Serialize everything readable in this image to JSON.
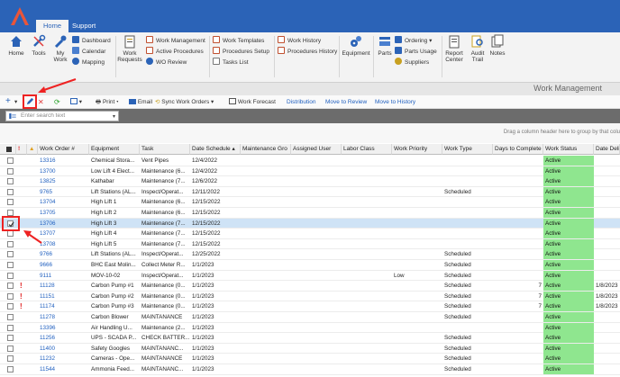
{
  "tabs": {
    "home": "Home",
    "support": "Support"
  },
  "ribbon": {
    "home": "Home",
    "tools": "Tools",
    "my_work": "My Work",
    "dashboard": "Dashboard",
    "calendar": "Calendar",
    "mapping": "Mapping",
    "work_requests": "Work Requests",
    "work_management": "Work Management",
    "active_procedures": "Active Procedures",
    "wo_review": "WO Review",
    "work_templates": "Work Templates",
    "procedures_setup": "Procedures Setup",
    "tasks_list": "Tasks List",
    "work_history": "Work History",
    "procedures_history": "Procedures History",
    "equipment": "Equipment",
    "parts": "Parts",
    "ordering": "Ordering",
    "parts_usage": "Parts Usage",
    "suppliers": "Suppliers",
    "report_center": "Report Center",
    "audit_trail": "Audit Trail",
    "notes": "Notes"
  },
  "section_title": "Work Management",
  "toolbar": {
    "print": "Print",
    "email": "Email",
    "sync": "Sync Work Orders",
    "work_forecast": "Work Forecast",
    "distribution": "Distribution",
    "move_review": "Move to Review",
    "move_history": "Move to History"
  },
  "search": {
    "placeholder": "Enter search text"
  },
  "group_hint": "Drag a column header here to group by that colu",
  "columns": {
    "alert": "!",
    "work_order": "Work Order #",
    "equipment": "Equipment",
    "task": "Task",
    "date_schedule": "Date Schedule",
    "maintenance_group": "Maintenance Gro",
    "assigned_user": "Assigned User",
    "labor_class": "Labor Class",
    "work_priority": "Work Priority",
    "work_type": "Work Type",
    "days_to_complete": "Days to Complete",
    "work_status": "Work Status",
    "date_delivered": "Date Deli"
  },
  "rows": [
    {
      "wo": "13316",
      "equipment": "Chemical Stora...",
      "task": "Vent Pipes",
      "date": "12/4/2022",
      "priority": "",
      "type": "",
      "days": "",
      "status": "Active",
      "deliv": "",
      "alert": false,
      "checked": false
    },
    {
      "wo": "13700",
      "equipment": "Low Lift 4 Elect...",
      "task": "Maintenance (6...",
      "date": "12/4/2022",
      "priority": "",
      "type": "",
      "days": "",
      "status": "Active",
      "deliv": "",
      "alert": false,
      "checked": false
    },
    {
      "wo": "13825",
      "equipment": "Kathabar",
      "task": "Maintenance (7...",
      "date": "12/6/2022",
      "priority": "",
      "type": "",
      "days": "",
      "status": "Active",
      "deliv": "",
      "alert": false,
      "checked": false
    },
    {
      "wo": "9765",
      "equipment": "Lift Stations (AL...",
      "task": "Inspect/Operat...",
      "date": "12/11/2022",
      "priority": "",
      "type": "Scheduled",
      "days": "",
      "status": "Active",
      "deliv": "",
      "alert": false,
      "checked": false
    },
    {
      "wo": "13704",
      "equipment": "High Lift 1",
      "task": "Maintenance (6...",
      "date": "12/15/2022",
      "priority": "",
      "type": "",
      "days": "",
      "status": "Active",
      "deliv": "",
      "alert": false,
      "checked": false
    },
    {
      "wo": "13705",
      "equipment": "High Lift 2",
      "task": "Maintenance (6...",
      "date": "12/15/2022",
      "priority": "",
      "type": "",
      "days": "",
      "status": "Active",
      "deliv": "",
      "alert": false,
      "checked": false
    },
    {
      "wo": "13706",
      "equipment": "High Lift 3",
      "task": "Maintenance (7...",
      "date": "12/15/2022",
      "priority": "",
      "type": "",
      "days": "",
      "status": "Active",
      "deliv": "",
      "alert": false,
      "checked": true
    },
    {
      "wo": "13707",
      "equipment": "High Lift 4",
      "task": "Maintenance (7...",
      "date": "12/15/2022",
      "priority": "",
      "type": "",
      "days": "",
      "status": "Active",
      "deliv": "",
      "alert": false,
      "checked": false
    },
    {
      "wo": "13708",
      "equipment": "High Lift 5",
      "task": "Maintenance (7...",
      "date": "12/15/2022",
      "priority": "",
      "type": "",
      "days": "",
      "status": "Active",
      "deliv": "",
      "alert": false,
      "checked": false
    },
    {
      "wo": "9766",
      "equipment": "Lift Stations (AL...",
      "task": "Inspect/Operat...",
      "date": "12/25/2022",
      "priority": "",
      "type": "Scheduled",
      "days": "",
      "status": "Active",
      "deliv": "",
      "alert": false,
      "checked": false
    },
    {
      "wo": "9666",
      "equipment": "BHC East Molin...",
      "task": "Collect Meter R...",
      "date": "1/1/2023",
      "priority": "",
      "type": "Scheduled",
      "days": "",
      "status": "Active",
      "deliv": "",
      "alert": false,
      "checked": false
    },
    {
      "wo": "9111",
      "equipment": "MOV-10-02",
      "task": "Inspect/Operat...",
      "date": "1/1/2023",
      "priority": "Low",
      "type": "Scheduled",
      "days": "",
      "status": "Active",
      "deliv": "",
      "alert": false,
      "checked": false
    },
    {
      "wo": "11128",
      "equipment": "Carbon Pump #1",
      "task": "Maintenance (0...",
      "date": "1/1/2023",
      "priority": "",
      "type": "Scheduled",
      "days": "7",
      "status": "Active",
      "deliv": "1/8/2023",
      "alert": true,
      "checked": false
    },
    {
      "wo": "11151",
      "equipment": "Carbon Pump #2",
      "task": "Maintenance (0...",
      "date": "1/1/2023",
      "priority": "",
      "type": "Scheduled",
      "days": "7",
      "status": "Active",
      "deliv": "1/8/2023",
      "alert": true,
      "checked": false
    },
    {
      "wo": "11174",
      "equipment": "Carbon Pump #3",
      "task": "Maintenance (0...",
      "date": "1/1/2023",
      "priority": "",
      "type": "Scheduled",
      "days": "7",
      "status": "Active",
      "deliv": "1/8/2023",
      "alert": true,
      "checked": false
    },
    {
      "wo": "11278",
      "equipment": "Carbon Blower",
      "task": "MAINTANANCE",
      "date": "1/1/2023",
      "priority": "",
      "type": "Scheduled",
      "days": "",
      "status": "Active",
      "deliv": "",
      "alert": false,
      "checked": false
    },
    {
      "wo": "13396",
      "equipment": "Air Handling U...",
      "task": "Maintenance (2...",
      "date": "1/1/2023",
      "priority": "",
      "type": "",
      "days": "",
      "status": "Active",
      "deliv": "",
      "alert": false,
      "checked": false
    },
    {
      "wo": "11256",
      "equipment": "UPS - SCADA P...",
      "task": "CHECK BATTER...",
      "date": "1/1/2023",
      "priority": "",
      "type": "Scheduled",
      "days": "",
      "status": "Active",
      "deliv": "",
      "alert": false,
      "checked": false
    },
    {
      "wo": "11400",
      "equipment": "Safety Googles",
      "task": "MAINTANANC...",
      "date": "1/1/2023",
      "priority": "",
      "type": "Scheduled",
      "days": "",
      "status": "Active",
      "deliv": "",
      "alert": false,
      "checked": false
    },
    {
      "wo": "11232",
      "equipment": "Cameras - Ope...",
      "task": "MAINTANANCE",
      "date": "1/1/2023",
      "priority": "",
      "type": "Scheduled",
      "days": "",
      "status": "Active",
      "deliv": "",
      "alert": false,
      "checked": false
    },
    {
      "wo": "11544",
      "equipment": "Ammonia Feed...",
      "task": "MAINTANANC...",
      "date": "1/1/2023",
      "priority": "",
      "type": "Scheduled",
      "days": "",
      "status": "Active",
      "deliv": "",
      "alert": false,
      "checked": false
    }
  ]
}
